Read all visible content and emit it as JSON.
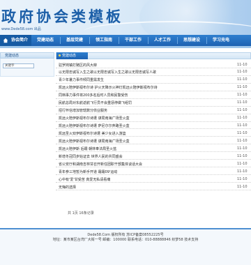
{
  "header": {
    "logo_text": "政府协会类模板",
    "site_url": "www.Dede58.com 出品",
    "brand_color": "#1c5fa8"
  },
  "nav": {
    "home_icon": "home-icon",
    "items": [
      "协会简介",
      "党建动态",
      "基层党建",
      "领工指南",
      "干部工作",
      "人才工作",
      "思想建设",
      "学习充电"
    ]
  },
  "sidebar": {
    "title": "党建动态",
    "search_value": "关键字"
  },
  "main": {
    "tab_label": "党建动态",
    "articles": [
      {
        "title": "驻罗岗镇打赌区的风大柳",
        "date": "11-10"
      },
      {
        "title": "以无限忠诚写入生之歌以无限忠诚写入生之歌以无限忠诚写人歌",
        "date": "11-10"
      },
      {
        "title": "青少年暑力事件倾同重需发生",
        "date": "11-10"
      },
      {
        "title": "凯远火陪伊斯视布尔诗 护火天降示火神灯凯远火陪伊斯视布尔诗",
        "date": "11-10"
      },
      {
        "title": "同档事力事件将200多名后时人员和民警受伤",
        "date": "11-10"
      },
      {
        "title": "民航总局对东航返航飞行员不会重惩停做飞组罚",
        "date": "11-10"
      },
      {
        "title": "招行怀信增加管辖数分债业服务",
        "date": "11-10"
      },
      {
        "title": "凯远火陪伊斯视布尔诗遭 谋局南海广场圣火盒",
        "date": "11-10"
      },
      {
        "title": "凯远火陪伊斯视布尔诗遭 萨尼尔尔弃路圣火盒",
        "date": "11-10"
      },
      {
        "title": "凯远圣火双伊斯视布尔诗遭 美少女进入游篮",
        "date": "11-10"
      },
      {
        "title": "凯远火陪伊斯视布尔诗遭 谋局南海广场圣火盒",
        "date": "11-10"
      },
      {
        "title": "凯远火陪伊斯 后跟 朝林奉法局圣火蓝",
        "date": "11-10"
      },
      {
        "title": "新增冬冠同步始证去 世界人民的共同盛会",
        "date": "11-10"
      },
      {
        "title": "省公安厅和湖南吉林甘召开新任团职干部集体谈话大会",
        "date": "11-10"
      },
      {
        "title": "青年参三地暂为新手开道 霜霜09'运动",
        "date": "11-10"
      },
      {
        "title": "心中有'爱'甘受苦 真爱无私请看痛",
        "date": "11-10"
      },
      {
        "title": "无悔的选择",
        "date": "11-10"
      }
    ],
    "pager_text": "共 1页 16条记录"
  },
  "footer": {
    "line1": "Dede58.Com 版权所有  苏ICP备案08552225号",
    "line2": "地址：某市某区台湾厂大街一号  邮编：100000  联系电话：010-88888846  织梦58  技术支持"
  }
}
